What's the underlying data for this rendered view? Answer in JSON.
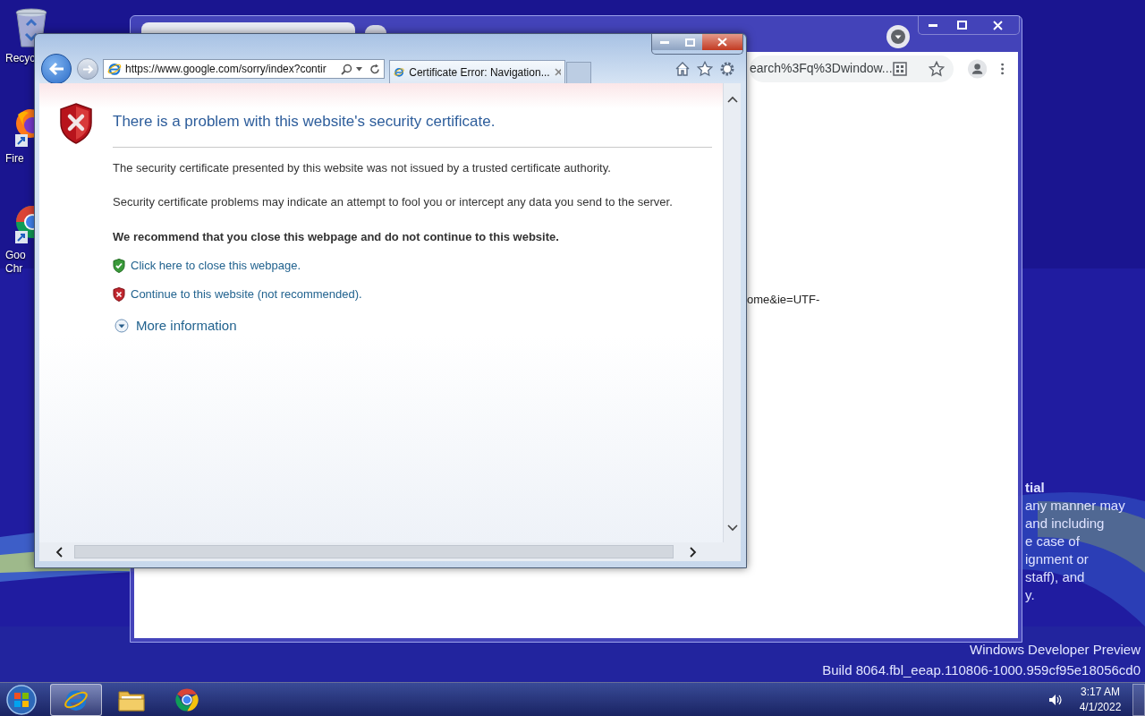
{
  "desktop": {
    "icons": [
      {
        "kind": "recycle-bin",
        "lines": [
          "Recyc"
        ]
      },
      {
        "kind": "firefox",
        "lines": [
          "Fire"
        ]
      },
      {
        "kind": "chrome",
        "lines": [
          "Goo",
          "Chr"
        ]
      }
    ],
    "notice_lines": [
      {
        "kind": "heading",
        "text": "tial"
      },
      {
        "kind": "text",
        "text": "any manner may"
      },
      {
        "kind": "text",
        "text": "and including"
      },
      {
        "kind": "text",
        "text": "e case of"
      },
      {
        "kind": "text",
        "text": "ignment or"
      },
      {
        "kind": "text",
        "text": "staff), and"
      },
      {
        "kind": "text",
        "text": "y."
      }
    ],
    "build_info": [
      "Windows Developer Preview",
      "Build 8064.fbl_eeap.110806-1000.959cf95e18056cd0"
    ]
  },
  "chrome_window": {
    "address": "earch%3Fq%3Dwindow...",
    "page_text": "ome&ie=UTF-"
  },
  "ie_window": {
    "address": "https://www.google.com/sorry/index?contir",
    "tabs": [
      {
        "label": "Certificate Error: Navigation...",
        "selected": true
      }
    ],
    "heading": "There is a problem with this website's security certificate.",
    "paragraphs": [
      "The security certificate presented by this website was not issued by a trusted certificate authority.",
      "Security certificate problems may indicate an attempt to fool you or intercept any data you send to the server."
    ],
    "recommendation": "We recommend that you close this webpage and do not continue to this website.",
    "links": [
      {
        "kind": "safe",
        "text": "Click here to close this webpage."
      },
      {
        "kind": "unsafe",
        "text": "Continue to this website (not recommended)."
      }
    ],
    "more_info": "More information"
  },
  "taskbar": {
    "apps": [
      {
        "kind": "ie",
        "selected": true
      },
      {
        "kind": "explorer",
        "selected": false
      },
      {
        "kind": "chrome",
        "selected": false
      }
    ],
    "time": "3:17 AM",
    "date": "4/1/2022"
  }
}
